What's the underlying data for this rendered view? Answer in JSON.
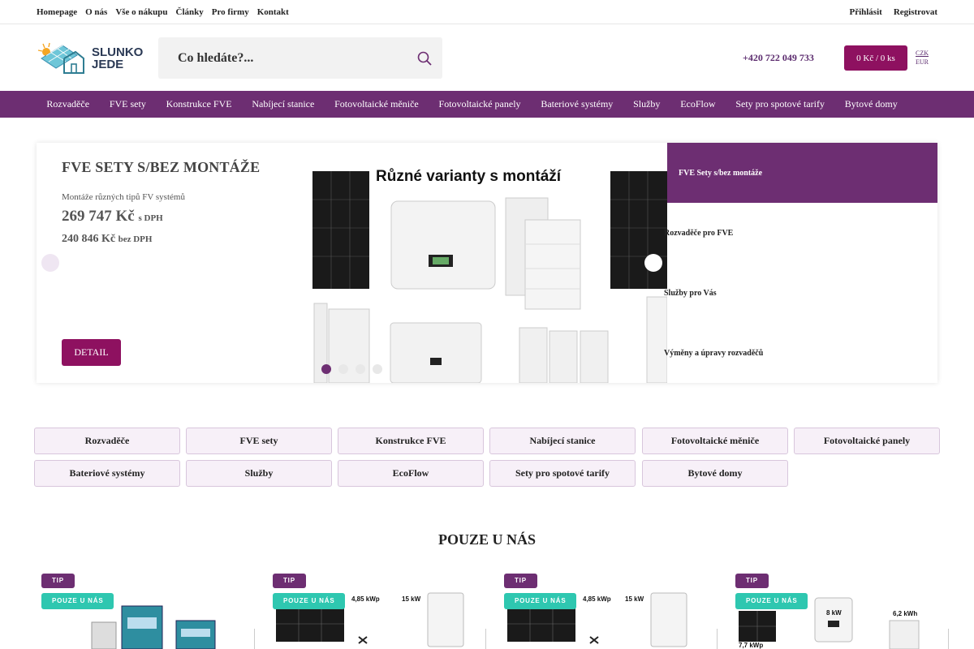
{
  "topbar": {
    "links": [
      "Homepage",
      "O nás",
      "Vše o nákupu",
      "Články",
      "Pro firmy",
      "Kontakt"
    ],
    "login": "Přihlásit",
    "register": "Registrovat"
  },
  "header": {
    "logo_line1": "SLUNKO",
    "logo_line2": "JEDE",
    "search_placeholder": "Co hledáte?...",
    "phone": "+420 722 049 733",
    "cart": "0 Kč / 0 ks",
    "currency_czk": "CZK",
    "currency_eur": "EUR"
  },
  "nav": [
    "Rozvaděče",
    "FVE sety",
    "Konstrukce FVE",
    "Nabíjecí stanice",
    "Fotovoltaické měniče",
    "Fotovoltaické panely",
    "Bateriové systémy",
    "Služby",
    "EcoFlow",
    "Sety pro spotové tarify",
    "Bytové domy"
  ],
  "hero": {
    "title": "FVE SETY S/BEZ MONTÁŽE",
    "subtitle": "Montáže různých tipů FV systémů",
    "price_with_vat": "269 747 Kč",
    "with_vat_label": "s DPH",
    "price_without_vat": "240 846 Kč",
    "without_vat_label": "bez DPH",
    "detail_button": "DETAIL",
    "image_heading": "Různé varianty s montáží",
    "side_items": [
      "FVE Sety s/bez montáže",
      "Rozvaděče pro FVE",
      "Služby pro Vás",
      "Výměny a úpravy rozvaděčů"
    ],
    "active_slide": 1,
    "slide_count": 4
  },
  "categories": [
    "Rozvaděče",
    "FVE sety",
    "Konstrukce FVE",
    "Nabíjecí stanice",
    "Fotovoltaické měniče",
    "Fotovoltaické panely",
    "Bateriové systémy",
    "Služby",
    "EcoFlow",
    "Sety pro spotové tarify",
    "Bytové domy"
  ],
  "section_title": "POUZE U NÁS",
  "badges": {
    "tip": "TIP",
    "only": "POUZE U NÁS"
  },
  "product_labels": {
    "card2": [
      "4,85 kWp",
      "15 kW"
    ],
    "card3": [
      "4,85 kWp",
      "15 kW"
    ],
    "card4": [
      "8 kW",
      "6,2 kWh",
      "7,7 kWp"
    ]
  },
  "colors": {
    "primary": "#6d2e72",
    "accent": "#8e1160",
    "teal": "#2ec7b0"
  }
}
